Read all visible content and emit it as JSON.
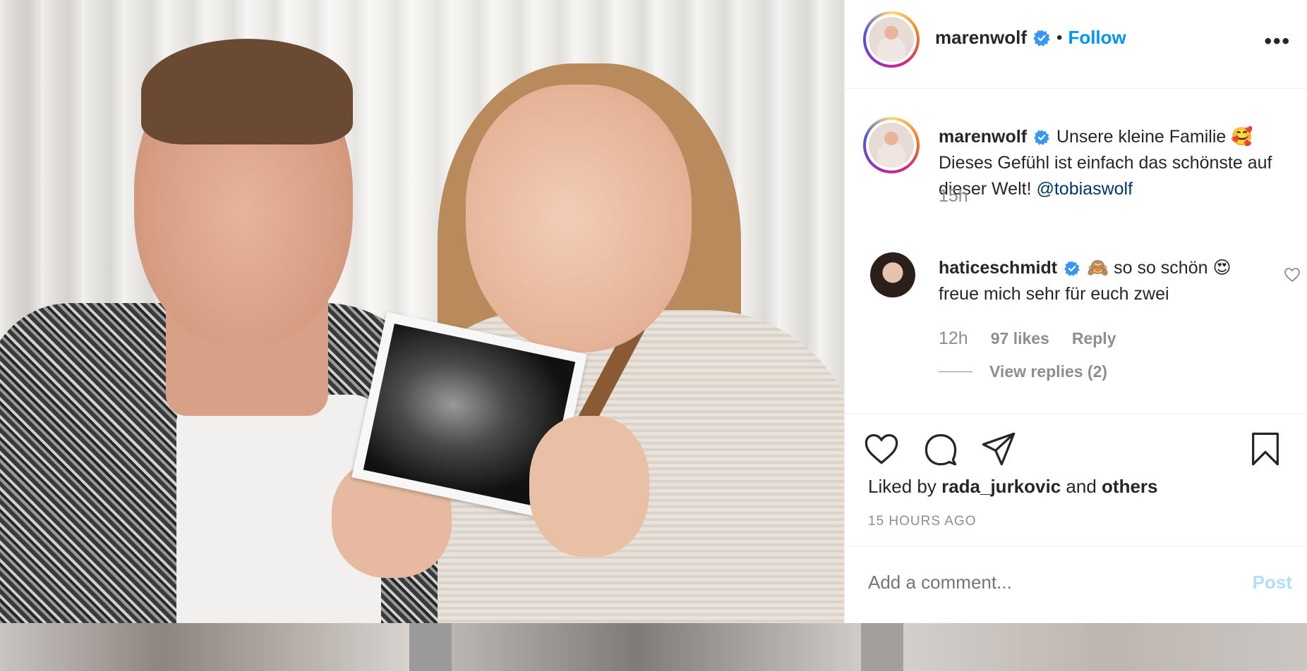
{
  "post": {
    "username": "marenwolf",
    "follow_label": "Follow",
    "separator": "•",
    "more_label": "•••",
    "caption_text": "Unsere kleine Familie 🥰 Dieses Gefühl ist einfach das schönste auf dieser Welt!",
    "caption_mention": "@tobiaswolf",
    "caption_time": "15h",
    "liked_prefix": "Liked by",
    "liked_user": "rada_jurkovic",
    "liked_and": "and",
    "liked_others": "others",
    "time_ago": "15 HOURS AGO"
  },
  "comment": {
    "username": "haticeschmidt",
    "text": "🙈 so so schön 😍 freue mich sehr für euch zwei",
    "time": "12h",
    "likes": "97 likes",
    "reply": "Reply",
    "view_replies": "View replies (2)"
  },
  "add_comment": {
    "placeholder": "Add a comment...",
    "post_label": "Post"
  },
  "colors": {
    "link_blue": "#0095f6",
    "mention": "#00376b",
    "muted": "#8e8e8e",
    "post_disabled": "#b2dffc"
  },
  "icons": [
    "verified-badge-icon",
    "heart-icon",
    "comment-icon",
    "share-icon",
    "bookmark-icon",
    "more-icon"
  ]
}
